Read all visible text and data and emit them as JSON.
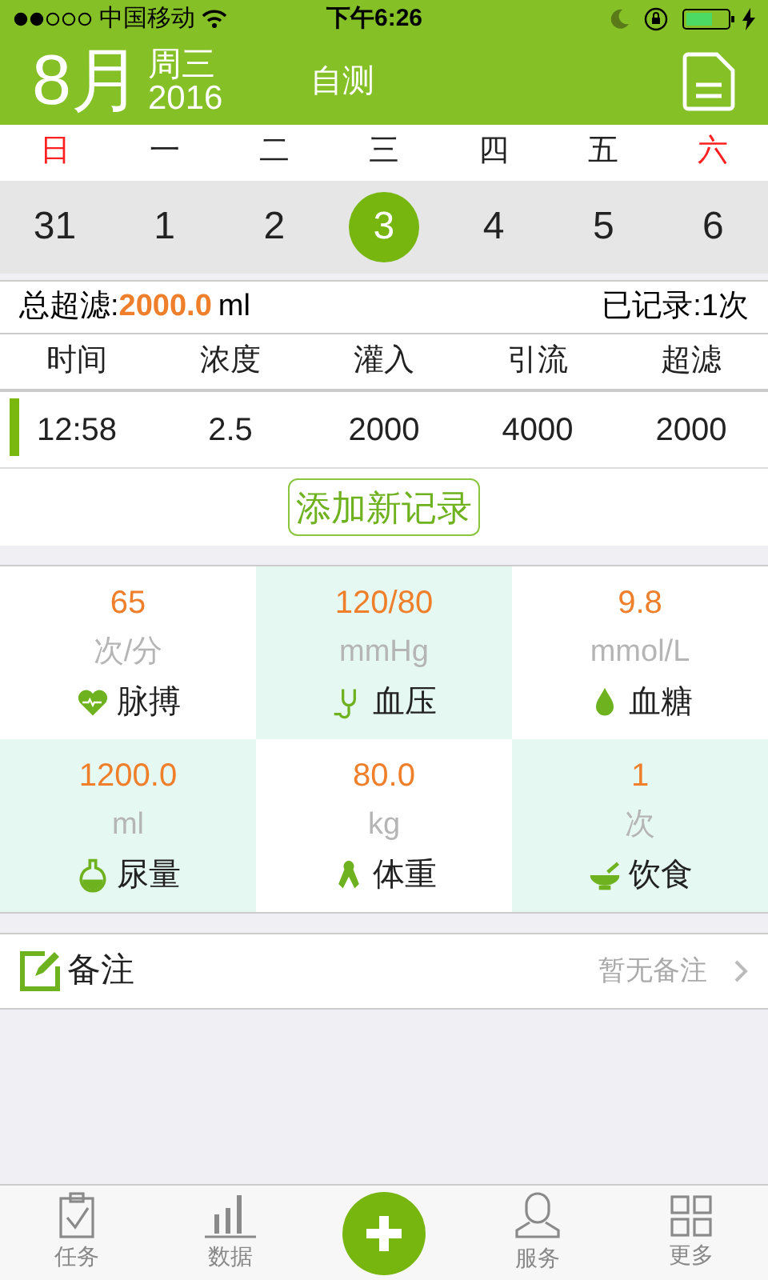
{
  "status_bar": {
    "carrier": "中国移动",
    "time": "下午6:26"
  },
  "header": {
    "month": "8月",
    "weekday": "周三",
    "year": "2016",
    "title": "自测"
  },
  "week": {
    "days": [
      {
        "label": "日",
        "weekend": true
      },
      {
        "label": "一",
        "weekend": false
      },
      {
        "label": "二",
        "weekend": false
      },
      {
        "label": "三",
        "weekend": false
      },
      {
        "label": "四",
        "weekend": false
      },
      {
        "label": "五",
        "weekend": false
      },
      {
        "label": "六",
        "weekend": true
      }
    ],
    "dates": [
      {
        "label": "31",
        "selected": false
      },
      {
        "label": "1",
        "selected": false
      },
      {
        "label": "2",
        "selected": false
      },
      {
        "label": "3",
        "selected": true
      },
      {
        "label": "4",
        "selected": false
      },
      {
        "label": "5",
        "selected": false
      },
      {
        "label": "6",
        "selected": false
      }
    ]
  },
  "summary": {
    "label": "总超滤:",
    "value": "2000.0",
    "unit": "ml",
    "count": "已记录:1次"
  },
  "table": {
    "columns": [
      "时间",
      "浓度",
      "灌入",
      "引流",
      "超滤"
    ],
    "rows": [
      {
        "cells": [
          "12:58",
          "2.5",
          "2000",
          "4000",
          "2000"
        ],
        "selected": true
      }
    ]
  },
  "add_button": "添加新记录",
  "metrics": [
    {
      "kind": "pulse",
      "reading": "65",
      "unit": "次/分",
      "name": "脉搏"
    },
    {
      "kind": "pressure",
      "reading": "120/80",
      "unit": "mmHg",
      "name": "血压"
    },
    {
      "kind": "sugar",
      "reading": "9.8",
      "unit": "mmol/L",
      "name": "血糖"
    },
    {
      "kind": "urine",
      "reading": "1200.0",
      "unit": "ml",
      "name": "尿量"
    },
    {
      "kind": "weight",
      "reading": "80.0",
      "unit": "kg",
      "name": "体重"
    },
    {
      "kind": "diet",
      "reading": "1",
      "unit": "次",
      "name": "饮食"
    }
  ],
  "notes": {
    "label": "备注",
    "value": "暂无备注"
  },
  "tab_bar": [
    {
      "kind": "tasks",
      "label": "任务"
    },
    {
      "kind": "data",
      "label": "数据"
    },
    {
      "kind": "add"
    },
    {
      "kind": "service",
      "label": "服务"
    },
    {
      "kind": "more",
      "label": "更多"
    }
  ]
}
